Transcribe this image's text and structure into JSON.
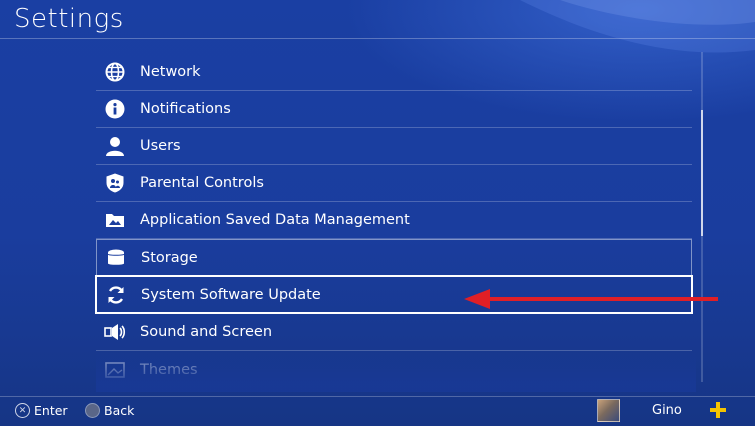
{
  "page": {
    "title": "Settings"
  },
  "menu": {
    "items": [
      {
        "label": "Network",
        "icon": "globe-icon"
      },
      {
        "label": "Notifications",
        "icon": "info-icon"
      },
      {
        "label": "Users",
        "icon": "user-icon"
      },
      {
        "label": "Parental Controls",
        "icon": "shield-family-icon"
      },
      {
        "label": "Application Saved Data Management",
        "icon": "folder-icon"
      },
      {
        "label": "Storage",
        "icon": "storage-icon"
      },
      {
        "label": "System Software Update",
        "icon": "refresh-icon",
        "selected": true
      },
      {
        "label": "Sound and Screen",
        "icon": "speaker-icon"
      },
      {
        "label": "Themes",
        "icon": "themes-icon"
      }
    ]
  },
  "annotation": {
    "arrow_color": "#e01f26"
  },
  "footer": {
    "enter_label": "Enter",
    "back_label": "Back",
    "user_name": "Gino"
  },
  "colors": {
    "background": "#1a3d9e",
    "accent_plus": "#f5c400"
  }
}
